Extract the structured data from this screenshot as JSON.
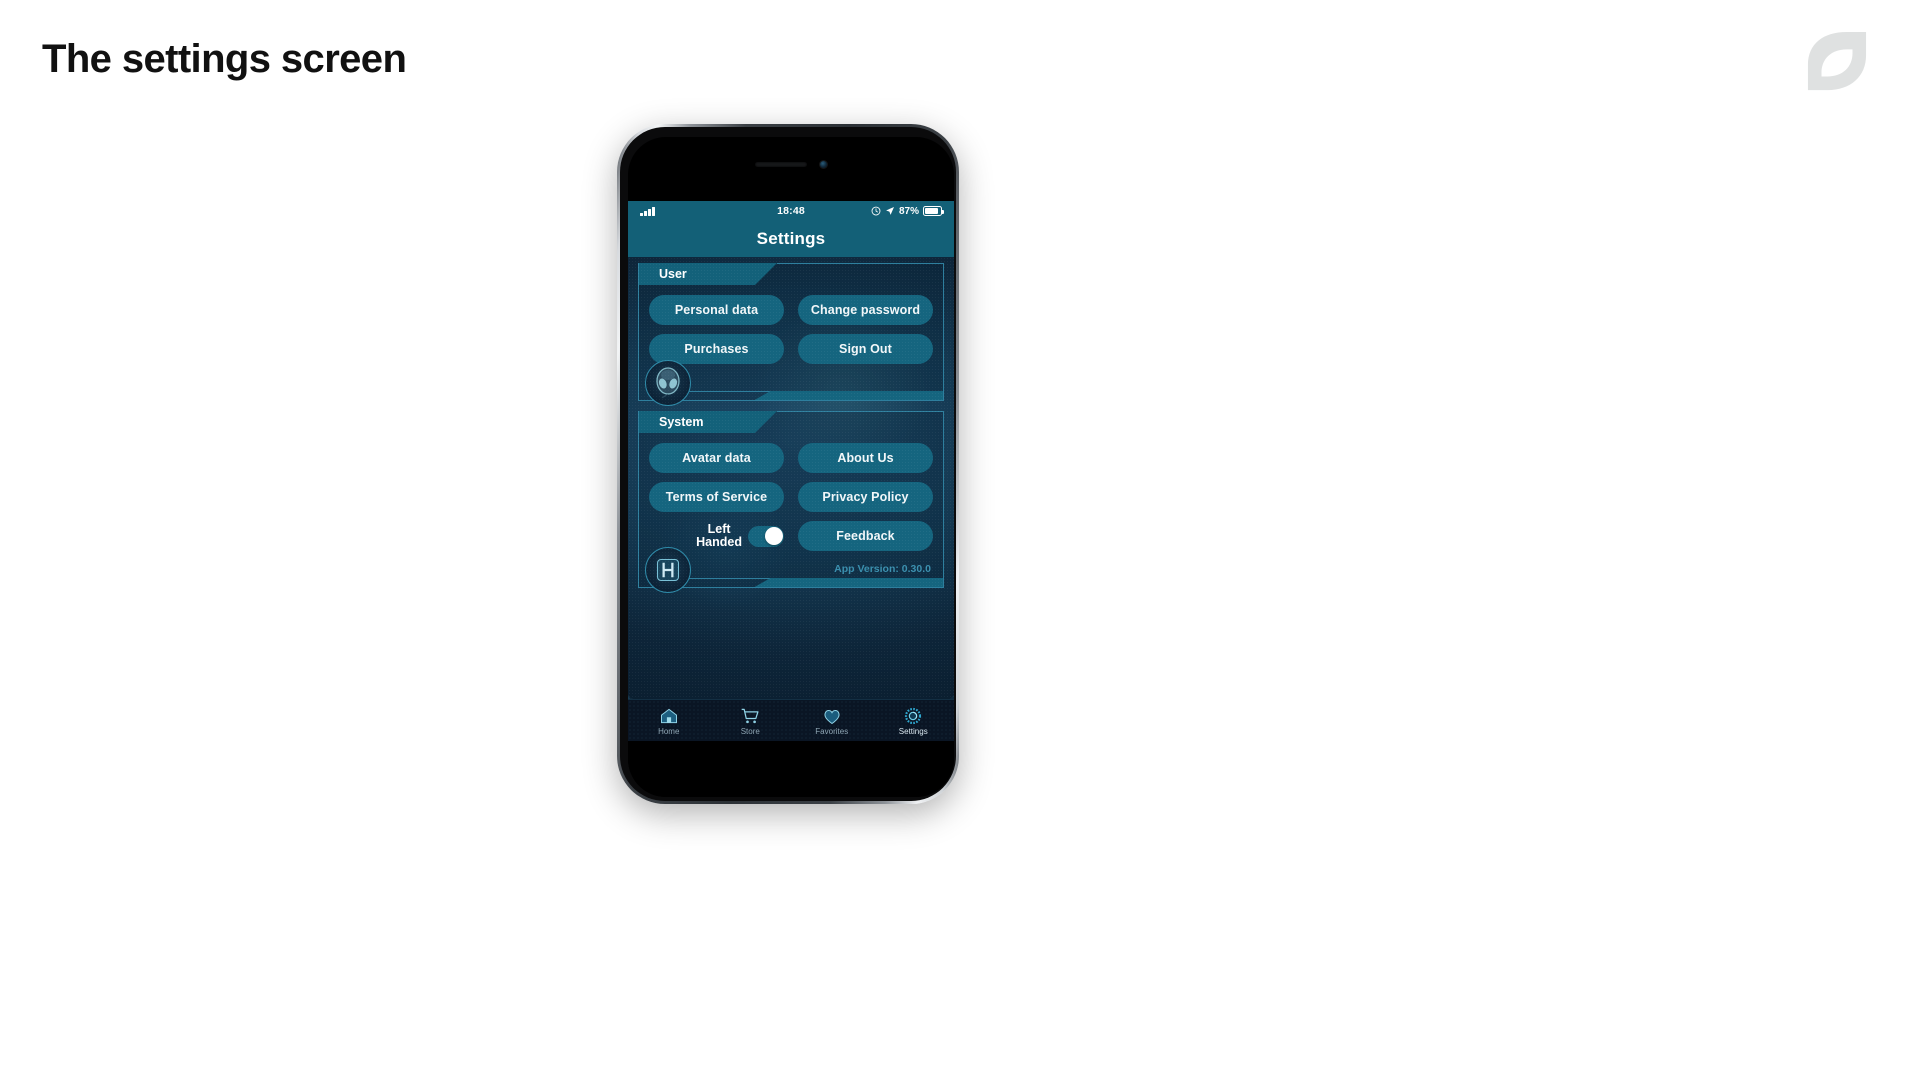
{
  "slide": {
    "title": "The settings screen",
    "logo_icon": "leaf-logo-icon",
    "logo_color": "#dfe1e1"
  },
  "phone": {
    "device": "iphone-mockup",
    "speaker_icon": "earpiece-speaker-icon",
    "camera_icon": "front-camera-icon"
  },
  "statusbar": {
    "signal_icon": "cellular-signal-icon",
    "time": "18:48",
    "alarm_icon": "alarm-clock-icon",
    "location_icon": "location-arrow-icon",
    "battery_percent": "87%",
    "battery_icon": "battery-icon",
    "background_color": "#136077"
  },
  "navbar": {
    "title": "Settings"
  },
  "sections": [
    {
      "id": "user",
      "header": "User",
      "buttons": [
        {
          "label": "Personal data"
        },
        {
          "label": "Change password"
        },
        {
          "label": "Purchases"
        },
        {
          "label": "Sign Out"
        }
      ],
      "badge_icon": "alien-head-icon"
    },
    {
      "id": "system",
      "header": "System",
      "buttons": [
        {
          "label": "Avatar data"
        },
        {
          "label": "About Us"
        },
        {
          "label": "Terms of Service"
        },
        {
          "label": "Privacy Policy"
        },
        {
          "label": "Feedback"
        }
      ],
      "toggle": {
        "label_line1": "Left",
        "label_line2": "Handed",
        "state": "on"
      },
      "badge_icon": "h-logo-icon",
      "version_text": "App Version: 0.30.0"
    }
  ],
  "tabbar": {
    "items": [
      {
        "label": "Home",
        "icon": "home-icon",
        "active": false
      },
      {
        "label": "Store",
        "icon": "cart-icon",
        "active": false
      },
      {
        "label": "Favorites",
        "icon": "heart-icon",
        "active": false
      },
      {
        "label": "Settings",
        "icon": "gear-icon",
        "active": true
      }
    ]
  },
  "theme": {
    "teal": "#15657f",
    "teal_dark": "#136077",
    "panel_border": "#2e7f9e",
    "version_text_color": "#3a8fae",
    "app_bg": "#0d1f30"
  }
}
